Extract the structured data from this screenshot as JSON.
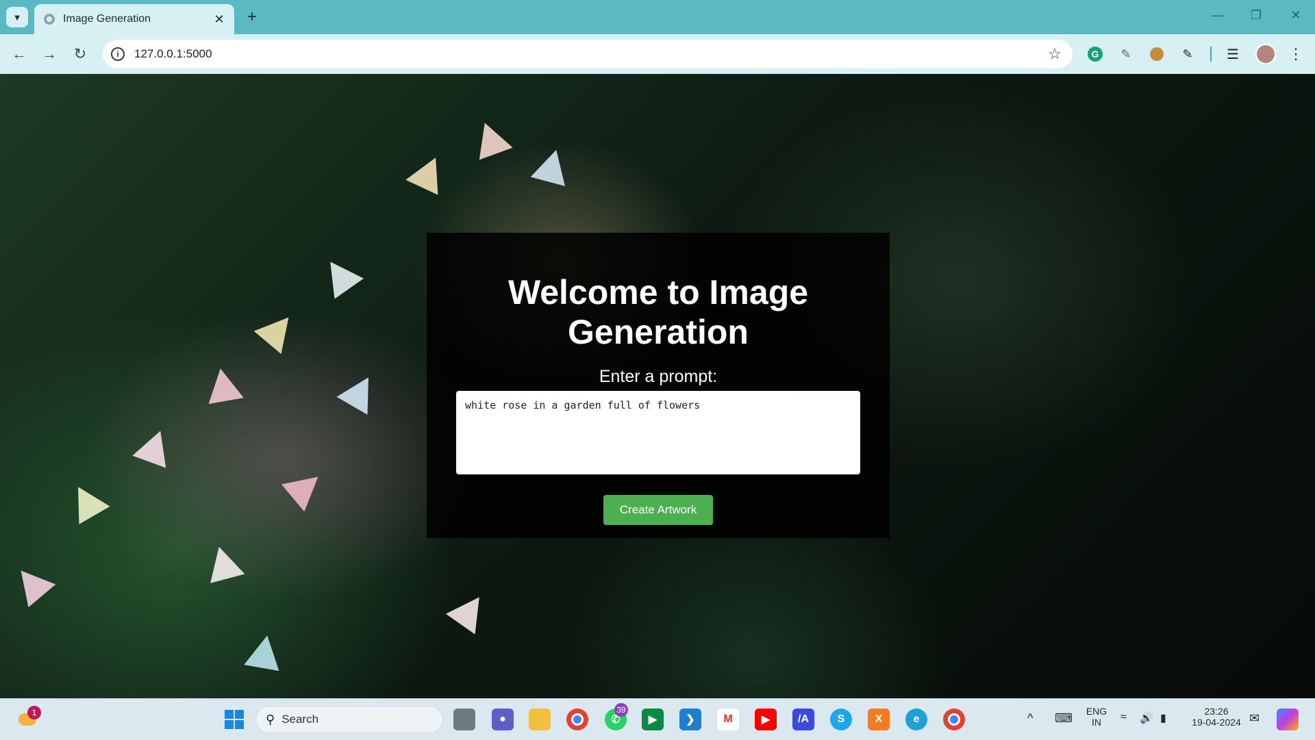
{
  "browser": {
    "tab_title": "Image Generation",
    "url": "127.0.0.1:5000"
  },
  "page": {
    "heading": "Welcome to Image Generation",
    "prompt_label": "Enter a prompt:",
    "prompt_value": "white rose in a garden full of flowers",
    "button_label": "Create Artwork",
    "button_color": "#4caf50"
  },
  "taskbar": {
    "search_label": "Search",
    "weather_badge": "1",
    "whatsapp_badge": "39",
    "language_line1": "ENG",
    "language_line2": "IN",
    "time": "23:26",
    "date": "19-04-2024"
  }
}
